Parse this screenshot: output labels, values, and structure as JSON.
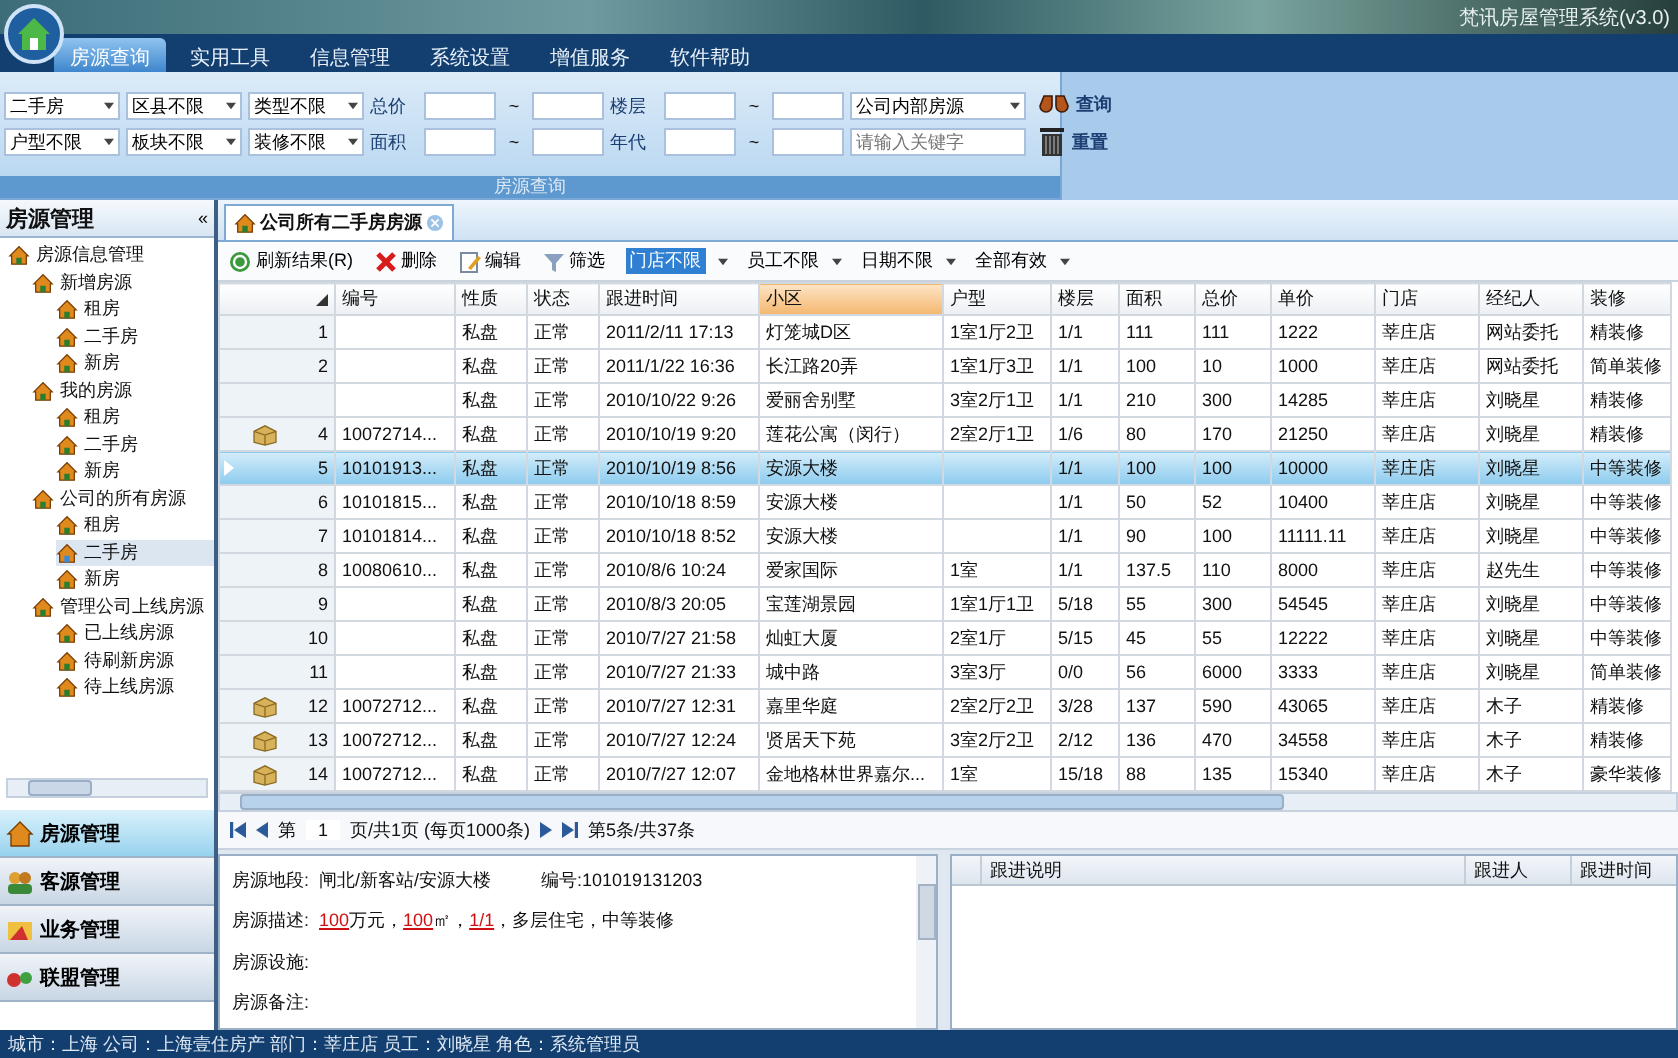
{
  "window": {
    "title": "梵讯房屋管理系统(v3.0)"
  },
  "menu": [
    {
      "label": "房源查询",
      "selected": true
    },
    {
      "label": "实用工具",
      "selected": false
    },
    {
      "label": "信息管理",
      "selected": false
    },
    {
      "label": "系统设置",
      "selected": false
    },
    {
      "label": "增值服务",
      "selected": false
    },
    {
      "label": "软件帮助",
      "selected": false
    }
  ],
  "query": {
    "rows": [
      [
        {
          "kind": "select",
          "value": "二手房"
        },
        {
          "kind": "select",
          "value": "区县不限"
        },
        {
          "kind": "select",
          "value": "类型不限"
        },
        {
          "kind": "label",
          "text": "总价"
        },
        {
          "kind": "input"
        },
        {
          "kind": "sep",
          "text": "~"
        },
        {
          "kind": "input"
        },
        {
          "kind": "label",
          "text": "楼层"
        },
        {
          "kind": "input"
        },
        {
          "kind": "sep",
          "text": "~"
        },
        {
          "kind": "input"
        },
        {
          "kind": "select",
          "value": "公司内部房源"
        }
      ],
      [
        {
          "kind": "select",
          "value": "户型不限"
        },
        {
          "kind": "select",
          "value": "板块不限"
        },
        {
          "kind": "select",
          "value": "装修不限"
        },
        {
          "kind": "label",
          "text": "面积"
        },
        {
          "kind": "input"
        },
        {
          "kind": "sep",
          "text": "~"
        },
        {
          "kind": "input"
        },
        {
          "kind": "label",
          "text": "年代"
        },
        {
          "kind": "input"
        },
        {
          "kind": "sep",
          "text": "~"
        },
        {
          "kind": "input"
        },
        {
          "kind": "search",
          "placeholder": "请输入关键字"
        }
      ]
    ],
    "buttons": [
      {
        "kind": "search",
        "label": "查询"
      },
      {
        "kind": "reset",
        "label": "重置"
      }
    ],
    "section_title": "房源查询"
  },
  "sidebar": {
    "title": "房源管理",
    "collapse": "«",
    "tree": [
      {
        "label": "房源信息管理",
        "selected": false,
        "children": [
          {
            "label": "新增房源",
            "selected": false,
            "children": [
              {
                "label": "租房",
                "selected": false
              },
              {
                "label": "二手房",
                "selected": false
              },
              {
                "label": "新房",
                "selected": false
              }
            ]
          },
          {
            "label": "我的房源",
            "selected": false,
            "children": [
              {
                "label": "租房",
                "selected": false
              },
              {
                "label": "二手房",
                "selected": false
              },
              {
                "label": "新房",
                "selected": false
              }
            ]
          },
          {
            "label": "公司的所有房源",
            "selected": false,
            "children": [
              {
                "label": "租房",
                "selected": false
              },
              {
                "label": "二手房",
                "selected": true
              },
              {
                "label": "新房",
                "selected": false
              }
            ]
          },
          {
            "label": "管理公司上线房源",
            "selected": false,
            "children": [
              {
                "label": "已上线房源",
                "selected": false
              },
              {
                "label": "待刷新房源",
                "selected": false
              },
              {
                "label": "待上线房源",
                "selected": false
              }
            ]
          }
        ]
      }
    ],
    "nav": [
      {
        "kind": "house",
        "label": "房源管理",
        "selected": true
      },
      {
        "kind": "client",
        "label": "客源管理",
        "selected": false
      },
      {
        "kind": "business",
        "label": "业务管理",
        "selected": false
      },
      {
        "kind": "alliance",
        "label": "联盟管理",
        "selected": false
      }
    ]
  },
  "doc_tab": {
    "label": "公司所有二手房房源"
  },
  "toolbar": {
    "buttons": [
      {
        "kind": "refresh",
        "label": "刷新结果(R)"
      },
      {
        "kind": "delete",
        "label": "删除"
      },
      {
        "kind": "edit",
        "label": "编辑"
      },
      {
        "kind": "filter",
        "label": "筛选"
      }
    ],
    "filters": [
      {
        "value": "门店不限",
        "selected": true
      },
      {
        "value": "员工不限",
        "selected": false
      },
      {
        "value": "日期不限",
        "selected": false
      },
      {
        "value": "全部有效",
        "selected": false
      }
    ]
  },
  "table": {
    "columns": [
      {
        "label": "编号",
        "highlighted": false
      },
      {
        "label": "性质",
        "highlighted": false
      },
      {
        "label": "状态",
        "highlighted": false
      },
      {
        "label": "跟进时间",
        "highlighted": false
      },
      {
        "label": "小区",
        "highlighted": true
      },
      {
        "label": "户型",
        "highlighted": false
      },
      {
        "label": "楼层",
        "highlighted": false
      },
      {
        "label": "面积",
        "highlighted": false
      },
      {
        "label": "总价",
        "highlighted": false
      },
      {
        "label": "单价",
        "highlighted": false
      },
      {
        "label": "门店",
        "highlighted": false
      },
      {
        "label": "经纪人",
        "highlighted": false
      },
      {
        "label": "装修",
        "highlighted": false
      }
    ],
    "rows": [
      {
        "num": "1",
        "box": false,
        "selected": false,
        "cells": [
          null,
          "私盘",
          "正常",
          "2011/2/11 17:13",
          "灯笼城D区",
          "1室1厅2卫",
          "1/1",
          "111",
          "111",
          "1222",
          "莘庄店",
          "网站委托",
          "精装修"
        ]
      },
      {
        "num": "2",
        "box": false,
        "selected": false,
        "cells": [
          null,
          "私盘",
          "正常",
          "2011/1/22 16:36",
          "长江路20弄",
          "1室1厅3卫",
          "1/1",
          "100",
          "10",
          "1000",
          "莘庄店",
          "网站委托",
          "简单装修"
        ]
      },
      {
        "box": false,
        "selected": false,
        "cells": [
          null,
          "私盘",
          "正常",
          "2010/10/22 9:26",
          "爱丽舍别墅",
          "3室2厅1卫",
          "1/1",
          "210",
          "300",
          "14285",
          "莘庄店",
          "刘晓星",
          "精装修"
        ]
      },
      {
        "num": "4",
        "box": true,
        "selected": false,
        "cells": [
          "10072714...",
          "私盘",
          "正常",
          "2010/10/19 9:20",
          "莲花公寓（闵行）",
          "2室2厅1卫",
          "1/6",
          "80",
          "170",
          "21250",
          "莘庄店",
          "刘晓星",
          "精装修"
        ]
      },
      {
        "num": "5",
        "box": false,
        "selected": true,
        "cells": [
          "10101913...",
          "私盘",
          "正常",
          "2010/10/19 8:56",
          "安源大楼",
          null,
          "1/1",
          "100",
          "100",
          "10000",
          "莘庄店",
          "刘晓星",
          "中等装修"
        ]
      },
      {
        "num": "6",
        "box": false,
        "selected": false,
        "cells": [
          "10101815...",
          "私盘",
          "正常",
          "2010/10/18 8:59",
          "安源大楼",
          null,
          "1/1",
          "50",
          "52",
          "10400",
          "莘庄店",
          "刘晓星",
          "中等装修"
        ]
      },
      {
        "num": "7",
        "box": false,
        "selected": false,
        "cells": [
          "10101814...",
          "私盘",
          "正常",
          "2010/10/18 8:52",
          "安源大楼",
          null,
          "1/1",
          "90",
          "100",
          "11111.11",
          "莘庄店",
          "刘晓星",
          "中等装修"
        ]
      },
      {
        "num": "8",
        "box": false,
        "selected": false,
        "cells": [
          "10080610...",
          "私盘",
          "正常",
          "2010/8/6 10:24",
          "爱家国际",
          "1室",
          "1/1",
          "137.5",
          "110",
          "8000",
          "莘庄店",
          "赵先生",
          "中等装修"
        ]
      },
      {
        "num": "9",
        "box": false,
        "selected": false,
        "cells": [
          null,
          "私盘",
          "正常",
          "2010/8/3 20:05",
          "宝莲湖景园",
          "1室1厅1卫",
          "5/18",
          "55",
          "300",
          "54545",
          "莘庄店",
          "刘晓星",
          "中等装修"
        ]
      },
      {
        "num": "10",
        "box": false,
        "selected": false,
        "cells": [
          null,
          "私盘",
          "正常",
          "2010/7/27 21:58",
          "灿虹大厦",
          "2室1厅",
          "5/15",
          "45",
          "55",
          "12222",
          "莘庄店",
          "刘晓星",
          "中等装修"
        ]
      },
      {
        "num": "11",
        "box": false,
        "selected": false,
        "cells": [
          null,
          "私盘",
          "正常",
          "2010/7/27 21:33",
          "城中路",
          "3室3厅",
          "0/0",
          "56",
          "6000",
          "3333",
          "莘庄店",
          "刘晓星",
          "简单装修"
        ]
      },
      {
        "num": "12",
        "box": true,
        "selected": false,
        "cells": [
          "10072712...",
          "私盘",
          "正常",
          "2010/7/27 12:31",
          "嘉里华庭",
          "2室2厅2卫",
          "3/28",
          "137",
          "590",
          "43065",
          "莘庄店",
          "木子",
          "精装修"
        ]
      },
      {
        "num": "13",
        "box": true,
        "selected": false,
        "cells": [
          "10072712...",
          "私盘",
          "正常",
          "2010/7/27 12:24",
          "贤居天下苑",
          "3室2厅2卫",
          "2/12",
          "136",
          "470",
          "34558",
          "莘庄店",
          "木子",
          "精装修"
        ]
      },
      {
        "num": "14",
        "box": true,
        "selected": false,
        "cells": [
          "10072712...",
          "私盘",
          "正常",
          "2010/7/27 12:07",
          "金地格林世界嘉尔...",
          "1室",
          "15/18",
          "88",
          "135",
          "15340",
          "莘庄店",
          "木子",
          "豪华装修"
        ]
      }
    ]
  },
  "pager": {
    "prefix": "第",
    "page": "1",
    "total": "页/共1页 (每页1000条)",
    "position": "第5条/共37条"
  },
  "detail": {
    "fields": [
      {
        "label": "房源地段:",
        "parts": [
          {
            "text": "闸北/新客站/安源大楼",
            "highlight": false
          }
        ],
        "extra": "编号:101019131203"
      },
      {
        "label": "房源描述:",
        "parts": [
          {
            "text": "100",
            "highlight": true
          },
          {
            "text": "万元，",
            "highlight": false
          },
          {
            "text": "100",
            "highlight": true
          },
          {
            "text": "㎡，",
            "highlight": false
          },
          {
            "text": "1/1",
            "highlight": true
          },
          {
            "text": "，多层住宅，中等装修",
            "highlight": false
          }
        ]
      },
      {
        "label": "房源设施:"
      },
      {
        "label": "房源备注:"
      }
    ]
  },
  "followups": {
    "columns": [
      "跟进说明",
      "跟进人",
      "跟进时间"
    ]
  },
  "status_bar": {
    "text": "城市：上海  公司：上海壹住房产  部门：莘庄店  员工：刘晓星  角色：系统管理员"
  }
}
